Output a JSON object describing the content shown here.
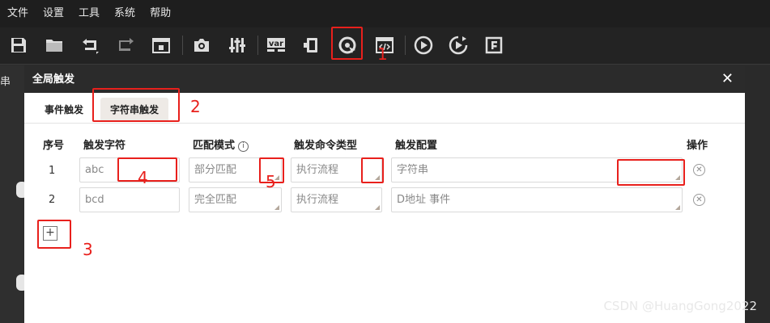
{
  "menubar": {
    "items": [
      "文件",
      "设置",
      "工具",
      "系统",
      "帮助"
    ]
  },
  "toolbar": {
    "icons": [
      "save-icon",
      "open-folder-icon",
      "undo-icon",
      "redo-icon",
      "lock-icon",
      "camera-icon",
      "sliders-icon",
      "variable-icon",
      "device-icon",
      "global-trigger-icon",
      "script-icon",
      "play-icon",
      "run-once-icon",
      "frame-icon"
    ],
    "var_label": "var"
  },
  "background": {
    "left_text": "串"
  },
  "dialog": {
    "title": "全局触发",
    "tabs": [
      {
        "label": "事件触发"
      },
      {
        "label": "字符串触发"
      }
    ],
    "columns": {
      "index": "序号",
      "trigger_string": "触发字符",
      "match_mode": "匹配模式",
      "command_type": "触发命令类型",
      "config": "触发配置",
      "action": "操作"
    },
    "info_glyph": "i",
    "rows": [
      {
        "index": "1",
        "trigger_string": "abc",
        "match_mode": "部分匹配",
        "command_type": "执行流程",
        "config": "字符串"
      },
      {
        "index": "2",
        "trigger_string": "bcd",
        "match_mode": "完全匹配",
        "command_type": "执行流程",
        "config": "D地址 事件"
      }
    ],
    "add_glyph": "+"
  },
  "annotations": [
    "1",
    "2",
    "3",
    "4",
    "5"
  ],
  "watermark": "CSDN @HuangGong2022",
  "colors": {
    "highlight": "#e8201c",
    "title_bar": "#2b2b2b",
    "active_tab": "#eeeae6"
  }
}
